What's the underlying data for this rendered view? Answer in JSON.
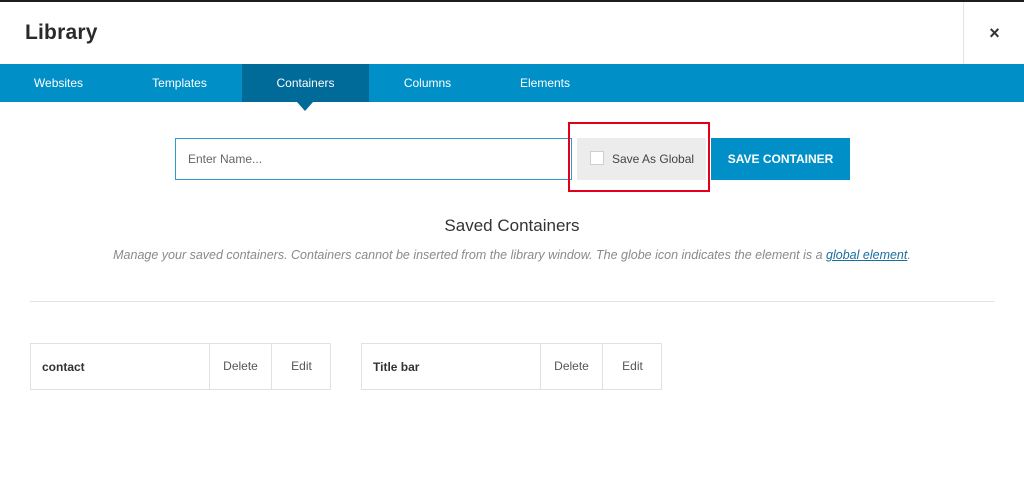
{
  "header": {
    "title": "Library",
    "close_label": "×"
  },
  "tabs": [
    {
      "label": "Websites"
    },
    {
      "label": "Templates"
    },
    {
      "label": "Containers"
    },
    {
      "label": "Columns"
    },
    {
      "label": "Elements"
    }
  ],
  "active_tab": "Containers",
  "form": {
    "name_placeholder": "Enter Name...",
    "name_value": "",
    "global_label": "Save As Global",
    "global_checked": false,
    "save_label": "SAVE CONTAINER"
  },
  "saved": {
    "title": "Saved Containers",
    "desc_prefix": "Manage your saved containers. Containers cannot be inserted from the library window. The globe icon indicates the element is a ",
    "desc_link": "global element",
    "desc_suffix": "."
  },
  "containers": [
    {
      "name": "contact",
      "delete_label": "Delete",
      "edit_label": "Edit"
    },
    {
      "name": "Title bar",
      "delete_label": "Delete",
      "edit_label": "Edit"
    }
  ],
  "colors": {
    "accent": "#0090c7",
    "active_tab": "#006a99",
    "highlight": "#e2001a"
  }
}
